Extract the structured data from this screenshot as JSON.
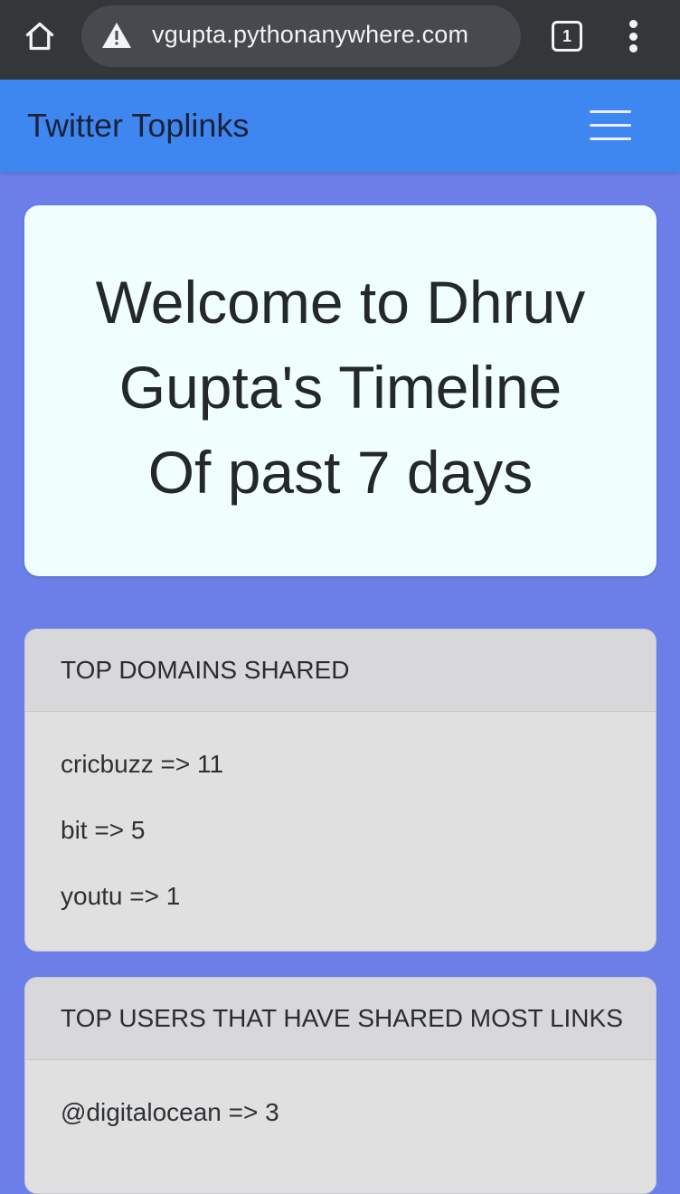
{
  "browser": {
    "url": "vgupta.pythonanywhere.com",
    "tab_count": "1",
    "icons": {
      "home": "home-icon",
      "warning": "warning-triangle-icon",
      "tabs": "tab-switcher-icon",
      "menu": "more-vert-icon"
    }
  },
  "navbar": {
    "brand": "Twitter Toplinks",
    "menu_icon": "hamburger-icon"
  },
  "hero": {
    "line1": "Welcome to Dhruv",
    "line2": "Gupta's Timeline",
    "line3": "Of past 7 days"
  },
  "domains_card": {
    "title": "TOP DOMAINS SHARED",
    "items": [
      "cricbuzz => 11",
      "bit => 5",
      "youtu => 1"
    ]
  },
  "users_card": {
    "title": "TOP USERS THAT HAVE SHARED MOST LINKS",
    "items": [
      "@digitalocean => 3"
    ]
  },
  "colors": {
    "page_background": "#6c7fe8",
    "navbar": "#3f87f0",
    "hero_background": "#f0fffe",
    "card_background": "#e0e0e0",
    "browser_toolbar": "#34373a"
  }
}
